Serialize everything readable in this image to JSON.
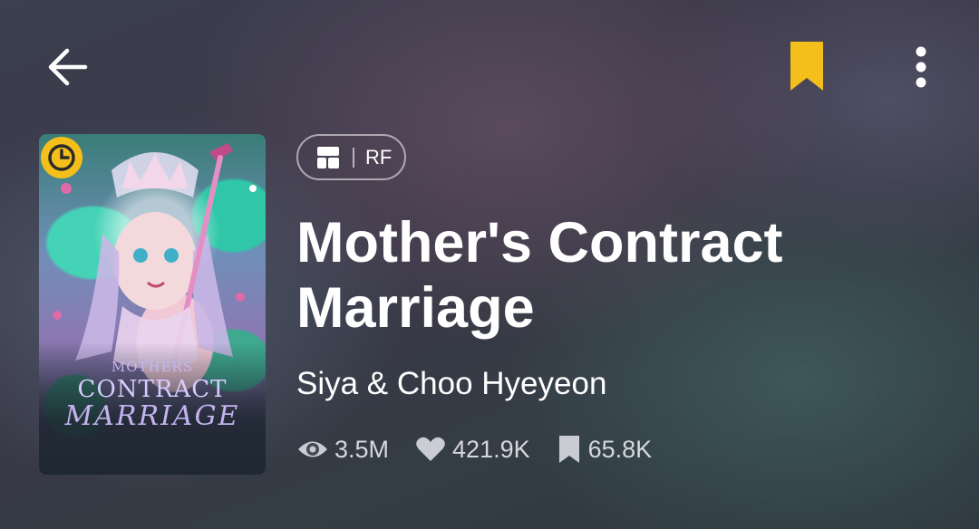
{
  "header": {
    "back_icon": "arrow-left-icon",
    "bookmark_icon": "bookmark-icon",
    "bookmark_color": "#f4bf1a",
    "more_icon": "more-vertical-icon"
  },
  "cover": {
    "badge_icon": "clock-icon",
    "badge_color": "#f4bf1a",
    "title_line1": "MOTHERS",
    "title_line2": "CONTRACT",
    "title_line3": "MARRIAGE"
  },
  "series": {
    "type_icon": "layout-grid-icon",
    "type_label": "RF",
    "title": "Mother's Contract Marriage",
    "author": "Siya & Choo Hyeyeon"
  },
  "stats": {
    "views": "3.5M",
    "likes": "421.9K",
    "bookmarks": "65.8K"
  }
}
